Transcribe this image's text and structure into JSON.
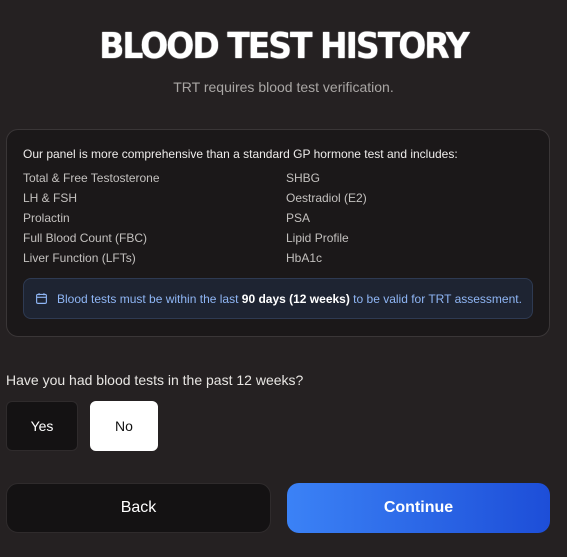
{
  "header": {
    "title": "BLOOD TEST HISTORY",
    "subtitle": "TRT requires blood test verification."
  },
  "panel": {
    "intro": "Our panel is more comprehensive than a standard GP hormone test and includes:",
    "tests": [
      "Total & Free Testosterone",
      "SHBG",
      "LH & FSH",
      "Oestradiol (E2)",
      "Prolactin",
      "PSA",
      "Full Blood Count (FBC)",
      "Lipid Profile",
      "Liver Function (LFTs)",
      "HbA1c"
    ],
    "notice": {
      "icon": "calendar-icon",
      "text_before": "Blood tests must be within the last ",
      "text_bold": "90 days (12 weeks)",
      "text_after": " to be valid for TRT assessment."
    }
  },
  "question": {
    "label": "Have you had blood tests in the past 12 weeks?",
    "options": [
      "Yes",
      "No"
    ],
    "selected": "No"
  },
  "navigation": {
    "back_label": "Back",
    "continue_label": "Continue"
  },
  "colors": {
    "background": "#252122",
    "panel": "#1b1819",
    "accent": "#3b82f6",
    "notice_text": "#8fb6f5"
  }
}
